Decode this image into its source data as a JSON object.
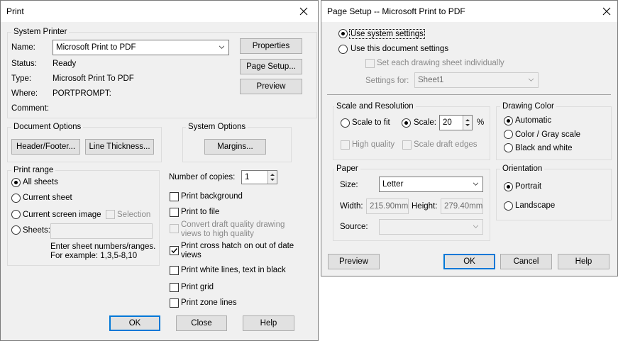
{
  "print": {
    "title": "Print",
    "system_printer": {
      "group_title": "System Printer",
      "name_label": "Name:",
      "name_value": "Microsoft Print to PDF",
      "status_label": "Status:",
      "status_value": "Ready",
      "type_label": "Type:",
      "type_value": "Microsoft Print To PDF",
      "where_label": "Where:",
      "where_value": "PORTPROMPT:",
      "comment_label": "Comment:",
      "properties_button": "Properties",
      "page_setup_button": "Page Setup...",
      "preview_button": "Preview"
    },
    "document_options": {
      "group_title": "Document Options",
      "header_footer_button": "Header/Footer...",
      "line_thickness_button": "Line Thickness..."
    },
    "system_options": {
      "group_title": "System Options",
      "margins_button": "Margins..."
    },
    "print_range": {
      "group_title": "Print range",
      "all_sheets": "All sheets",
      "current_sheet": "Current sheet",
      "current_screen_image": "Current screen image",
      "selection": "Selection",
      "sheets": "Sheets:",
      "sheets_value": "",
      "hint_line1": "Enter sheet numbers/ranges.",
      "hint_line2": "For example: 1,3,5-8,10",
      "selected": "All sheets"
    },
    "copies": {
      "label": "Number of copies:",
      "value": "1"
    },
    "options": [
      {
        "label": "Print background",
        "checked": false,
        "enabled": true
      },
      {
        "label": "Print to file",
        "checked": false,
        "enabled": true
      },
      {
        "label": "Convert draft quality drawing views to high quality",
        "line1": "Convert draft quality drawing",
        "line2": "views to high quality",
        "checked": false,
        "enabled": false
      },
      {
        "label": "Print cross hatch on out of date views",
        "line1": "Print cross hatch on out of date",
        "line2": "views",
        "checked": true,
        "enabled": true
      },
      {
        "label": "Print white lines, text in black",
        "checked": false,
        "enabled": true
      },
      {
        "label": "Print grid",
        "checked": false,
        "enabled": true
      },
      {
        "label": "Print zone lines",
        "checked": false,
        "enabled": true
      }
    ],
    "ok_button": "OK",
    "close_button": "Close",
    "help_button": "Help"
  },
  "page_setup": {
    "title": "Page Setup -- Microsoft Print to PDF",
    "use_system_settings": "Use system settings",
    "use_document_settings": "Use this document settings",
    "set_each_sheet": "Set each drawing sheet individually",
    "settings_for_label": "Settings for:",
    "settings_for_value": "Sheet1",
    "scale_resolution": {
      "group_title": "Scale and Resolution",
      "scale_to_fit": "Scale to fit",
      "scale": "Scale:",
      "scale_value": "20",
      "percent": "%",
      "high_quality": "High quality",
      "scale_draft_edges": "Scale draft edges"
    },
    "drawing_color": {
      "group_title": "Drawing Color",
      "automatic": "Automatic",
      "color_gray": "Color / Gray scale",
      "black_white": "Black and white",
      "selected": "Automatic"
    },
    "paper": {
      "group_title": "Paper",
      "size_label": "Size:",
      "size_value": "Letter",
      "width_label": "Width:",
      "width_value": "215.90mm",
      "height_label": "Height:",
      "height_value": "279.40mm",
      "source_label": "Source:",
      "source_value": ""
    },
    "orientation": {
      "group_title": "Orientation",
      "portrait": "Portrait",
      "landscape": "Landscape",
      "selected": "Portrait"
    },
    "preview_button": "Preview",
    "ok_button": "OK",
    "cancel_button": "Cancel",
    "help_button": "Help"
  },
  "colors": {
    "dialog_bg": "#f0f0f0",
    "accent": "#0078d7",
    "button_bg": "#e1e1e1"
  }
}
